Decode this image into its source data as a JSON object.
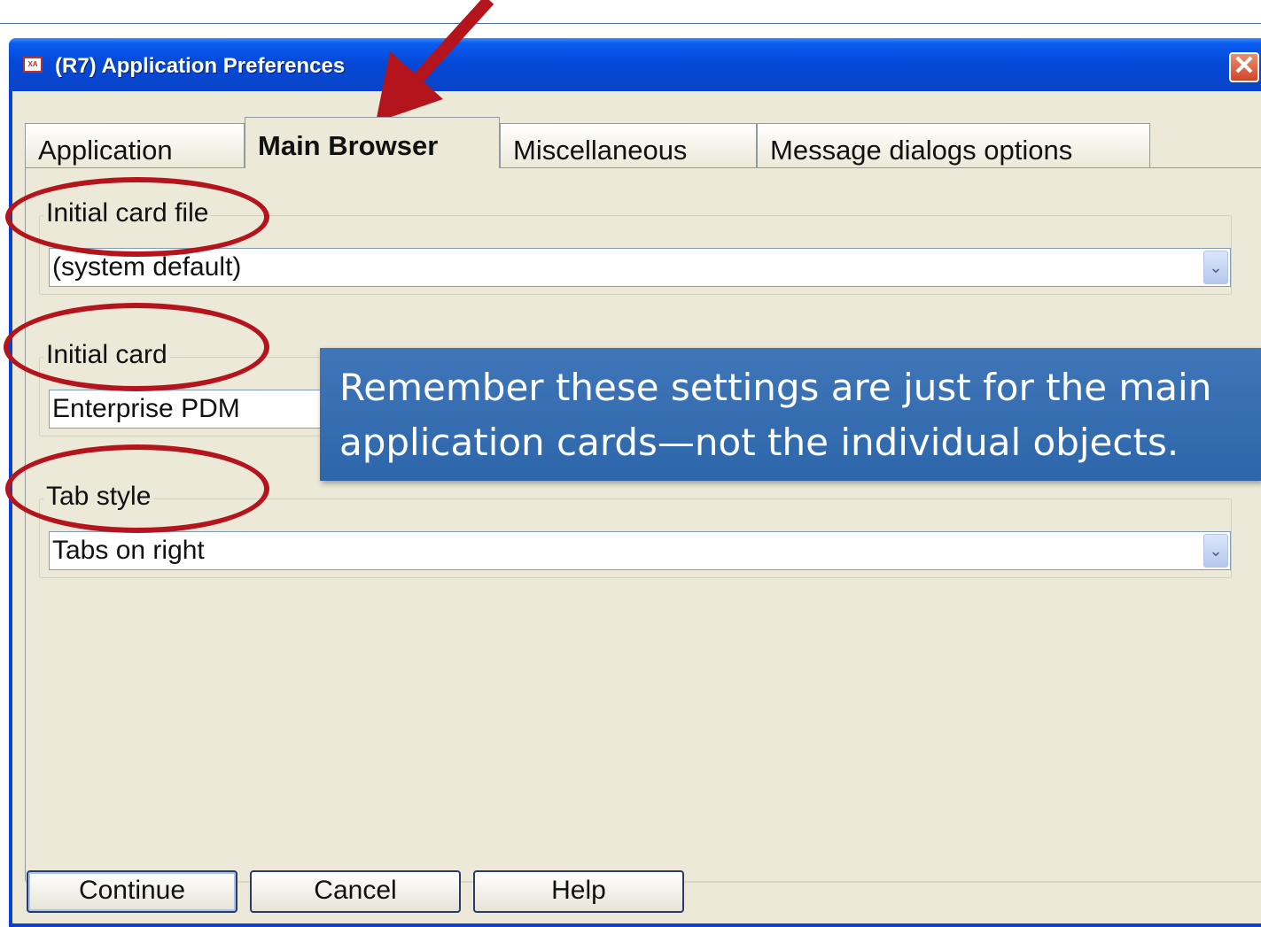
{
  "window": {
    "title": "(R7) Application Preferences",
    "app_icon": "XA",
    "close_glyph": "✕"
  },
  "tabs": [
    {
      "label": "Application",
      "active": false
    },
    {
      "label": "Main Browser",
      "active": true
    },
    {
      "label": "Miscellaneous",
      "active": false
    },
    {
      "label": "Message dialogs options",
      "active": false
    }
  ],
  "groups": {
    "initial_card_file": {
      "label": "Initial card file",
      "value": "(system default)"
    },
    "initial_card": {
      "label": "Initial card",
      "value": "Enterprise PDM"
    },
    "tab_style": {
      "label": "Tab style",
      "value": "Tabs on right"
    }
  },
  "buttons": {
    "continue": "Continue",
    "cancel": "Cancel",
    "help": "Help"
  },
  "callout": {
    "text": "Remember these settings are just for the main application cards—not the individual objects."
  },
  "colors": {
    "annotation_red": "#b4151c",
    "callout_blue": "#3a70b4",
    "titlebar_blue": "#0549d8",
    "dialog_bg": "#ece9d8"
  },
  "icons": {
    "dropdown": "chevron-down-icon",
    "close": "close-icon",
    "app": "app-icon"
  }
}
